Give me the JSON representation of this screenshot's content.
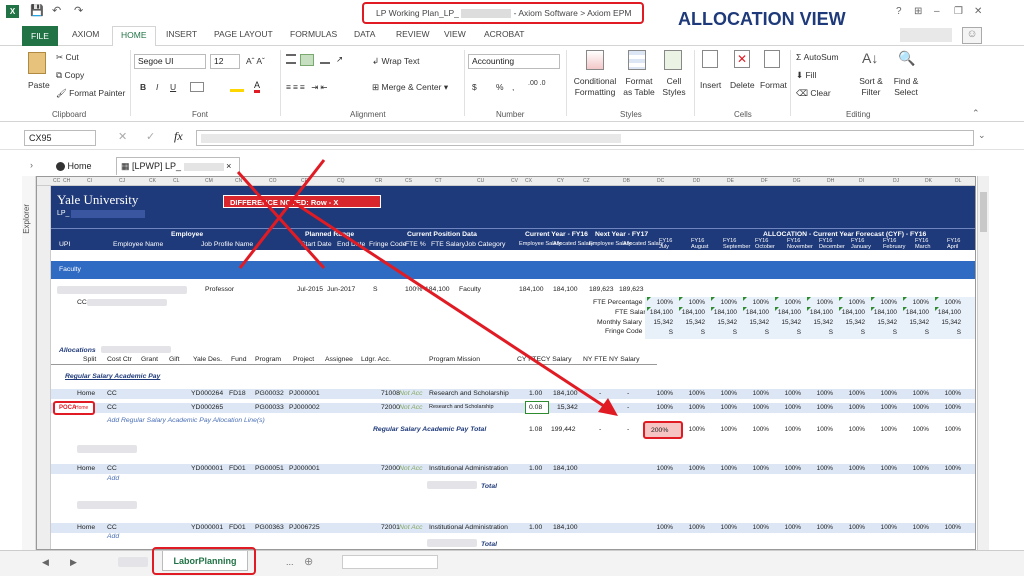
{
  "window": {
    "title": "LP Working Plan_LP_",
    "title_suffix": "- Axiom Software > Axiom EPM",
    "annotation": "ALLOCATION VIEW",
    "controls": [
      "?",
      "⊞",
      "–",
      "❐",
      "✕"
    ]
  },
  "ribbon_tabs": [
    "FILE",
    "AXIOM",
    "HOME",
    "INSERT",
    "PAGE LAYOUT",
    "FORMULAS",
    "DATA",
    "REVIEW",
    "VIEW",
    "ACROBAT"
  ],
  "clipboard": {
    "paste": "Paste",
    "cut": "Cut",
    "copy": "Copy",
    "format_painter": "Format Painter",
    "label": "Clipboard"
  },
  "font": {
    "name": "Segoe UI",
    "size": "12",
    "label": "Font",
    "bold": "B",
    "italic": "I",
    "underline": "U"
  },
  "alignment": {
    "wrap": "Wrap Text",
    "merge": "Merge & Center",
    "label": "Alignment"
  },
  "number": {
    "format": "Accounting",
    "currency": "$",
    "percent": "%",
    "comma": ",",
    "label": "Number"
  },
  "styles": {
    "conditional": "Conditional Formatting",
    "format_table": "Format as Table",
    "cell_styles": "Cell Styles",
    "label": "Styles"
  },
  "cells": {
    "insert": "Insert",
    "delete": "Delete",
    "format": "Format",
    "label": "Cells"
  },
  "editing": {
    "autosum": "AutoSum",
    "fill": "Fill",
    "clear": "Clear",
    "sort": "Sort & Filter",
    "find": "Find & Select",
    "label": "Editing"
  },
  "namebox": "CX95",
  "fx": "fx",
  "doc_tabs": {
    "home": "Home",
    "lpwp": "[LPWP] LP_",
    "explorer": "Explorer"
  },
  "col_headers": [
    "CC",
    "CH",
    "CI",
    "CJ",
    "CK",
    "CL",
    "CM",
    "CN",
    "CO",
    "CP",
    "CQ",
    "CR",
    "CS",
    "CT",
    "CU",
    "CV",
    "CW",
    "CX",
    "CY",
    "CZ",
    "DA",
    "DB",
    "DC",
    "DD",
    "DE",
    "DF",
    "DG",
    "DH",
    "DI",
    "DJ",
    "DK",
    "DL"
  ],
  "sheet": {
    "institution": "Yale University",
    "lp": "LP_",
    "diff_banner": "DIFFERENCE NOTED: Row - X",
    "sections": {
      "employee": "Employee",
      "planned": "Planned Range",
      "position": "Current Position Data",
      "cy": "Current Year - FY16",
      "ny": "Next Year - FY17",
      "alloc": "ALLOCATION - Current Year Forecast (CYF) - FY16"
    },
    "headers": [
      "UPI",
      "Employee Name",
      "Job Profile Name",
      "Start Date",
      "End Date",
      "Fringe Code",
      "FTE %",
      "FTE Salary",
      "Job Category",
      "Employee Salary",
      "Allocated Salary",
      "Employee Salary",
      "Allocated Salary"
    ],
    "months": [
      [
        "FY16",
        "July"
      ],
      [
        "FY16",
        "August"
      ],
      [
        "FY16",
        "September"
      ],
      [
        "FY16",
        "October"
      ],
      [
        "FY16",
        "November"
      ],
      [
        "FY16",
        "December"
      ],
      [
        "FY16",
        "January"
      ],
      [
        "FY16",
        "February"
      ],
      [
        "FY16",
        "March"
      ],
      [
        "FY16",
        "April"
      ]
    ],
    "faculty_label": "Faculty",
    "emp_row": {
      "cc": "CC",
      "job": "Professor",
      "start": "Jul-2015",
      "end": "Jun-2017",
      "fringe": "S",
      "fte": "100%",
      "salary": "184,100",
      "cat": "Faculty",
      "cy_emp": "184,100",
      "cy_alloc": "184,100",
      "ny_emp": "189,623",
      "ny_alloc": "189,623"
    },
    "metrics": [
      "FTE Percentage",
      "FTE Salary",
      "Monthly Salary",
      "Fringe Code"
    ],
    "metric_values": [
      "100%",
      "184,100",
      "15,342",
      "S"
    ],
    "alloc_title": "Allocations",
    "alloc_headers": [
      "Split",
      "Cost Ctr",
      "Grant",
      "Gift",
      "Yale Des.",
      "Fund",
      "Program",
      "Project",
      "Assignee",
      "Ldgr. Acc.",
      "Program Mission",
      "CY FTE",
      "CY Salary",
      "NY FTE",
      "NY Salary"
    ],
    "group1": "Regular Salary Academic Pay",
    "rows": [
      {
        "split": "Home",
        "cc": "CC",
        "des": "YD000264",
        "fund": "FD18",
        "prog": "PG00032",
        "proj": "PJ000001",
        "ldgr": "71008",
        "acc": "Not Acc",
        "mission": "Research and Scholarship",
        "fte": "1.00",
        "sal": "184,100",
        "nyf": "-",
        "nys": "-"
      },
      {
        "split": "Home",
        "cc": "CC",
        "des": "YD000265",
        "fund": "",
        "prog": "PG00033",
        "proj": "PJ000002",
        "ldgr": "72000",
        "acc": "Not Acc",
        "mission": "Research and Scholarship",
        "fte": "0.08",
        "sal": "15,342",
        "nyf": "",
        "nys": "-"
      }
    ],
    "poca_tag": "POCA",
    "add_line": "Add Regular Salary Academic Pay Allocation Line(s)",
    "total_label": "Regular Salary Academic Pay Total",
    "total": {
      "fte": "1.08",
      "sal": "199,442",
      "nyf": "-",
      "nys": "-",
      "first_pct": "200%"
    },
    "row_group2": {
      "split": "Home",
      "cc": "CC",
      "des": "YD000001",
      "fund": "FD01",
      "prog": "PG00051",
      "proj": "PJ000001",
      "ldgr": "72000",
      "acc": "Not Acc",
      "mission": "Institutional Administration",
      "fte": "1.00",
      "sal": "184,100"
    },
    "row_group3": {
      "split": "Home",
      "cc": "CC",
      "des": "YD000001",
      "fund": "FD01",
      "prog": "PG00363",
      "proj": "PJ006725",
      "ldgr": "72001",
      "acc": "Not Acc",
      "mission": "Institutional Administration",
      "fte": "1.00",
      "sal": "184,100"
    },
    "add_short": "Add",
    "total_short": "Total"
  },
  "sheet_tab": "LaborPlanning",
  "colors": {
    "navy": "#1f3a7a",
    "blue_band": "#2f6bc2",
    "light_blue": "#dce6f4",
    "red": "#e01b24",
    "excel_green": "#217346"
  }
}
